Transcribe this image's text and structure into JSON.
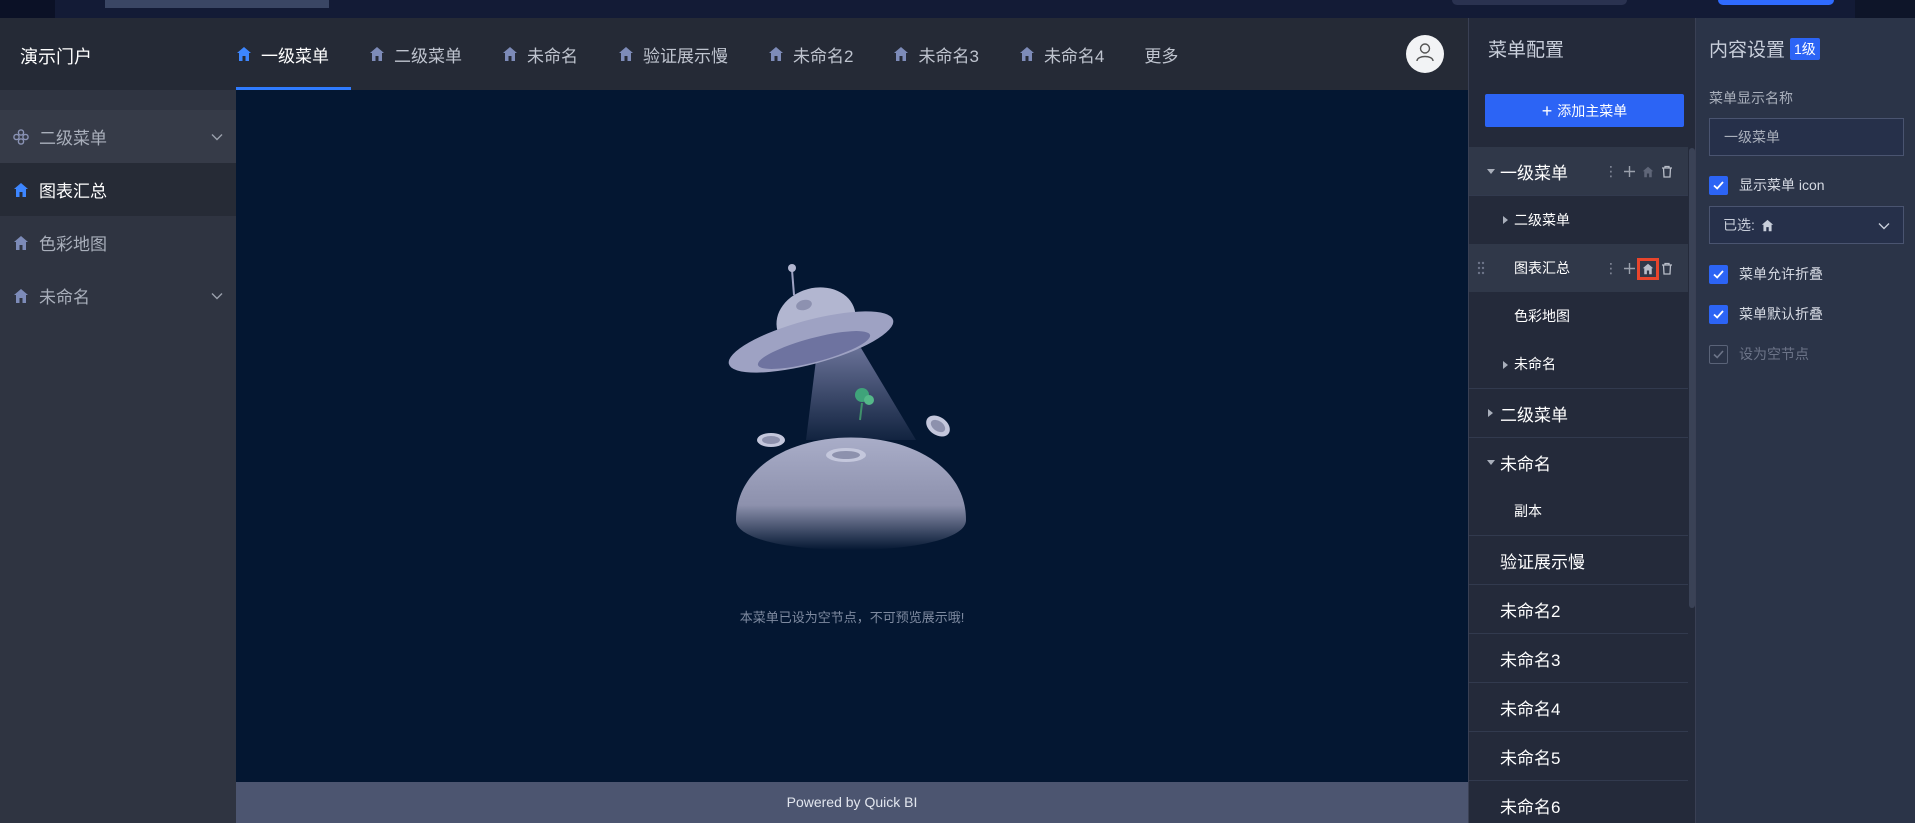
{
  "brand": "演示门户",
  "nav": {
    "items": [
      {
        "label": "一级菜单",
        "active": true
      },
      {
        "label": "二级菜单"
      },
      {
        "label": "未命名"
      },
      {
        "label": "验证展示慢"
      },
      {
        "label": "未命名2"
      },
      {
        "label": "未命名3"
      },
      {
        "label": "未命名4"
      }
    ],
    "more": "更多"
  },
  "sidebar": {
    "items": [
      {
        "label": "二级菜单",
        "icon": "component-icon"
      },
      {
        "label": "图表汇总",
        "icon": "home-icon",
        "active": true
      },
      {
        "label": "色彩地图",
        "icon": "home-icon"
      },
      {
        "label": "未命名",
        "icon": "home-icon"
      }
    ]
  },
  "main": {
    "empty_text": "本菜单已设为空节点，不可预览展示哦!",
    "footer": "Powered by Quick BI"
  },
  "menu_panel": {
    "title": "菜单配置",
    "add_button": "添加主菜单",
    "tree": [
      {
        "label": "一级菜单",
        "level": 1,
        "expanded": true
      },
      {
        "label": "二级菜单",
        "level": 2
      },
      {
        "label": "图表汇总",
        "level": 2
      },
      {
        "label": "色彩地图",
        "level": 2
      },
      {
        "label": "未命名",
        "level": 2
      },
      {
        "label": "二级菜单",
        "level": 1
      },
      {
        "label": "未命名",
        "level": 1,
        "expanded": true
      },
      {
        "label": "副本",
        "level": 2
      },
      {
        "label": "验证展示慢",
        "level": 1
      },
      {
        "label": "未命名2",
        "level": 1
      },
      {
        "label": "未命名3",
        "level": 1
      },
      {
        "label": "未命名4",
        "level": 1
      },
      {
        "label": "未命名5",
        "level": 1
      },
      {
        "label": "未命名6",
        "level": 1
      }
    ]
  },
  "content_panel": {
    "title": "内容设置",
    "badge": "1级",
    "field_label": "菜单显示名称",
    "name_value": "一级菜单",
    "show_icon_label": "显示菜单 icon",
    "icon_select_prefix": "已选:",
    "allow_collapse_label": "菜单允许折叠",
    "default_collapse_label": "菜单默认折叠",
    "empty_node_label": "设为空节点"
  },
  "colors": {
    "accent": "#2c64f5",
    "highlight": "#e8452c",
    "canvas": "#041732"
  }
}
